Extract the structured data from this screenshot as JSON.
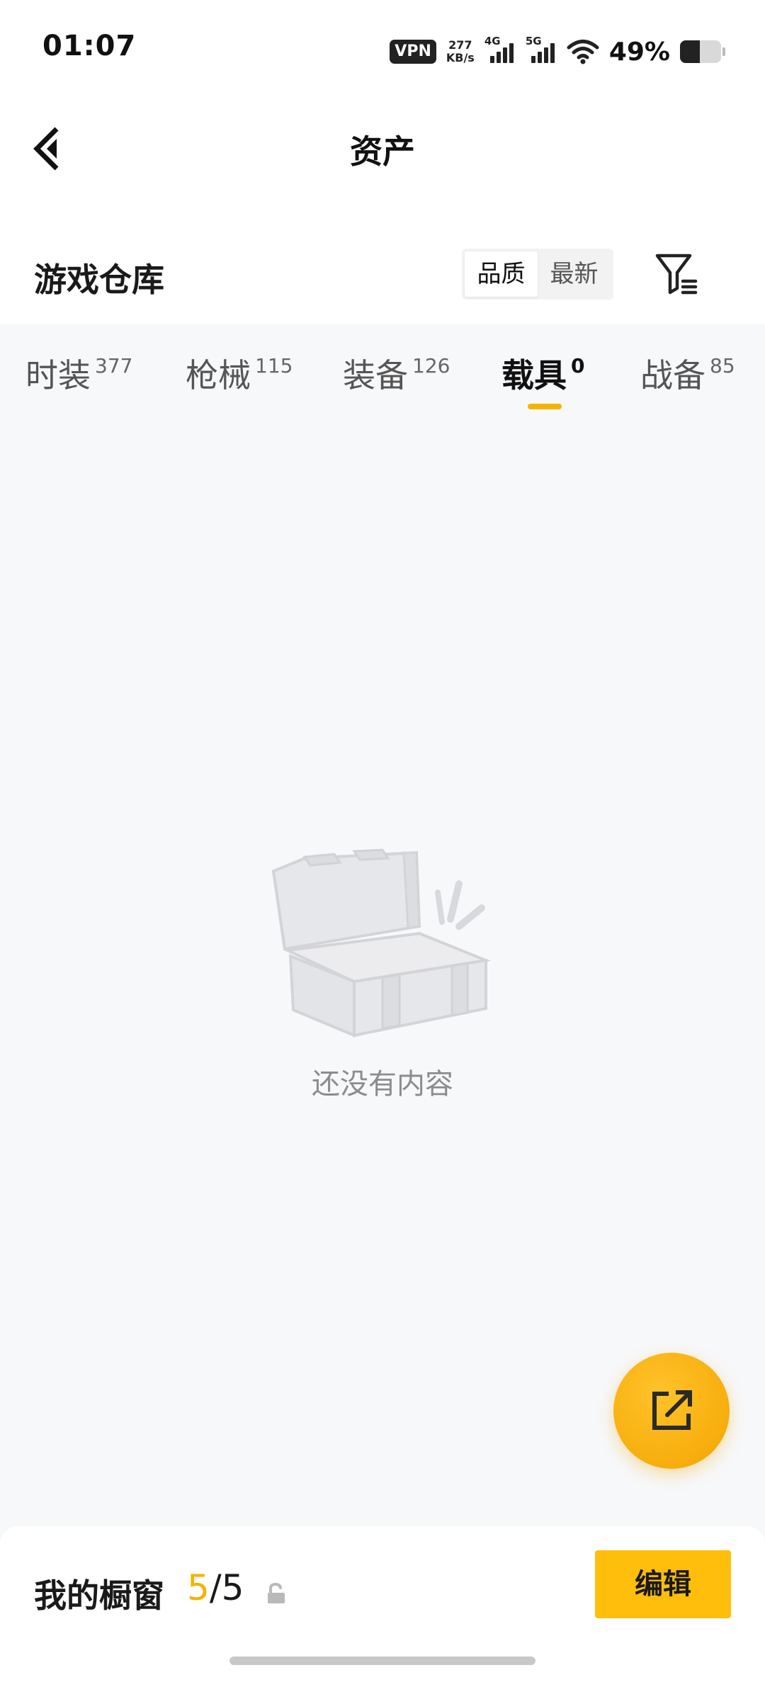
{
  "status_bar": {
    "time": "01:07",
    "vpn": "VPN",
    "net_speed_value": "277",
    "net_speed_unit": "KB/s",
    "signal_1": "4G",
    "signal_2": "5G",
    "battery_percent": "49%",
    "battery_level": 0.49
  },
  "header": {
    "title": "资产",
    "back_icon": "chevron-left-icon"
  },
  "section": {
    "title": "游戏仓库",
    "sort_options": [
      "品质",
      "最新"
    ],
    "selected_sort": "品质",
    "filter_icon": "filter-icon"
  },
  "tabs": [
    {
      "label": "时装",
      "count": "377",
      "active": false
    },
    {
      "label": "枪械",
      "count": "115",
      "active": false
    },
    {
      "label": "装备",
      "count": "126",
      "active": false
    },
    {
      "label": "载具",
      "count": "0",
      "active": true
    },
    {
      "label": "战备",
      "count": "85",
      "active": false
    }
  ],
  "empty_state": {
    "illustration": "empty-box-illustration",
    "text": "还没有内容"
  },
  "fab": {
    "icon": "share-external-icon"
  },
  "bottom_bar": {
    "label": "我的橱窗",
    "count_current": "5",
    "count_sep": "/",
    "count_total": "5",
    "lock_icon": "lock-icon",
    "edit_label": "编辑"
  },
  "colors": {
    "accent": "#f5b301",
    "button": "#ffbe0b",
    "background": "#f7f8fa"
  }
}
